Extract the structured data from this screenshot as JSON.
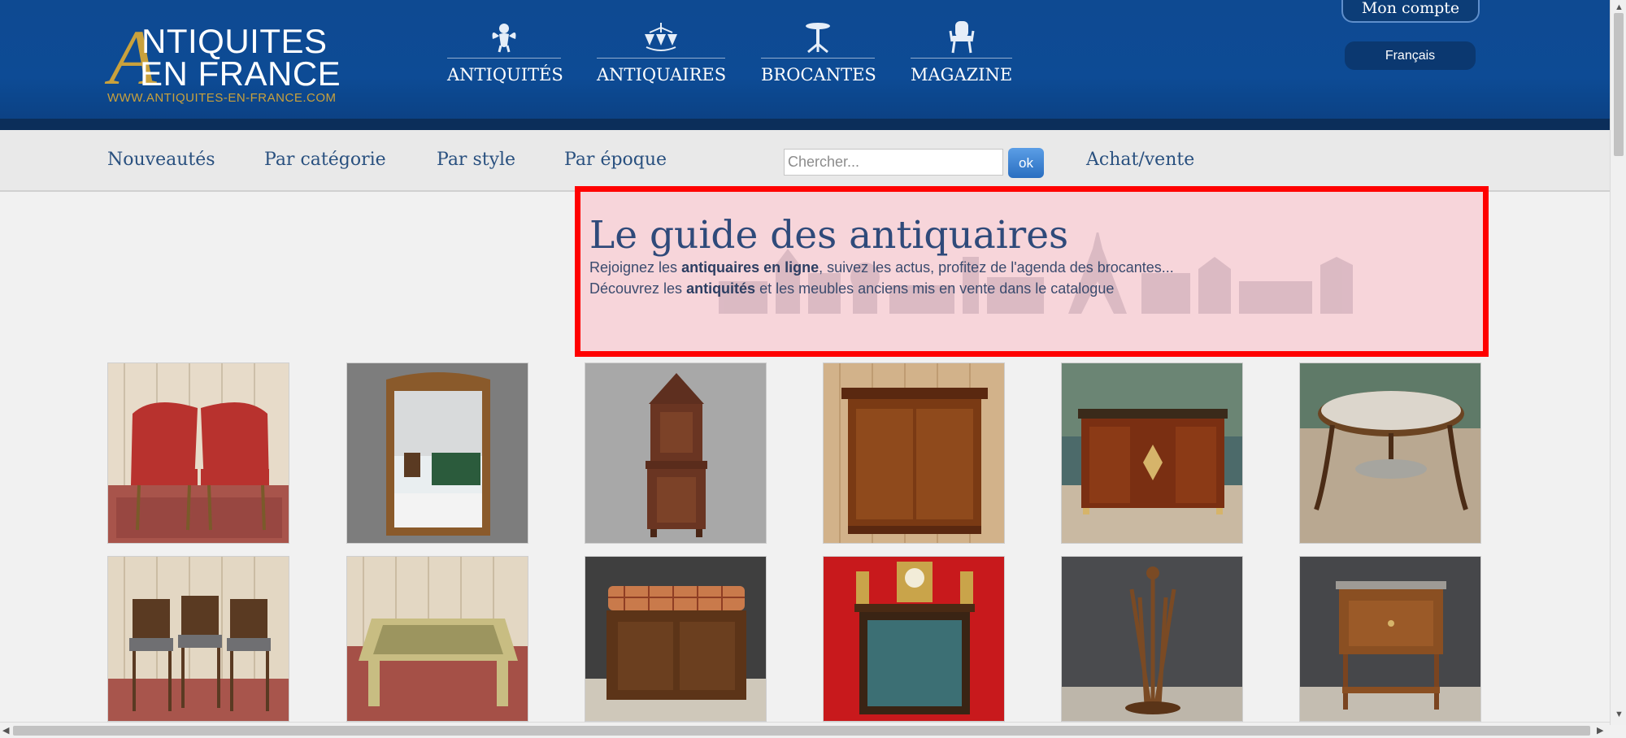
{
  "colors": {
    "header_blue": "#0d4b95",
    "gold": "#c9a13c",
    "link_blue": "#29507f",
    "highlight_red": "#ff0000"
  },
  "logo": {
    "big_letter": "A",
    "line1": "NTIQUITES",
    "line2": "EN FRANCE",
    "url": "WWW.ANTIQUITES-EN-FRANCE.COM"
  },
  "main_nav": [
    {
      "label": "ANTIQUITÉS",
      "icon": "cherub-icon"
    },
    {
      "label": "ANTIQUAIRES",
      "icon": "chandelier-icon"
    },
    {
      "label": "BROCANTES",
      "icon": "pedestal-table-icon"
    },
    {
      "label": "MAGAZINE",
      "icon": "armchair-icon"
    }
  ],
  "account": {
    "label": "Mon compte"
  },
  "language": {
    "label": "Français"
  },
  "sub_nav": [
    {
      "label": "Nouveautés"
    },
    {
      "label": "Par catégorie"
    },
    {
      "label": "Par style"
    },
    {
      "label": "Par époque"
    },
    {
      "label": "Achat/vente"
    }
  ],
  "search": {
    "placeholder": "Chercher...",
    "button_label": "ok"
  },
  "hero": {
    "title": "Le guide des antiquaires",
    "line1_pre": "Rejoignez les ",
    "line1_bold": "antiquaires en ligne",
    "line1_post": ", suivez les actus, profitez de l'agenda des brocantes...",
    "line2_pre": "Découvrez les ",
    "line2_bold": "antiquités",
    "line2_post": " et les meubles anciens mis en vente dans le catalogue"
  },
  "products": [
    {
      "name": "pair-of-red-armchairs"
    },
    {
      "name": "wall-mirror"
    },
    {
      "name": "carved-cabinet"
    },
    {
      "name": "wardrobe"
    },
    {
      "name": "sideboard"
    },
    {
      "name": "round-marble-table"
    },
    {
      "name": "set-of-chairs"
    },
    {
      "name": "coffee-table"
    },
    {
      "name": "blanket-chest"
    },
    {
      "name": "vitrine-with-clock"
    },
    {
      "name": "cane-stand"
    },
    {
      "name": "nightstand"
    }
  ]
}
